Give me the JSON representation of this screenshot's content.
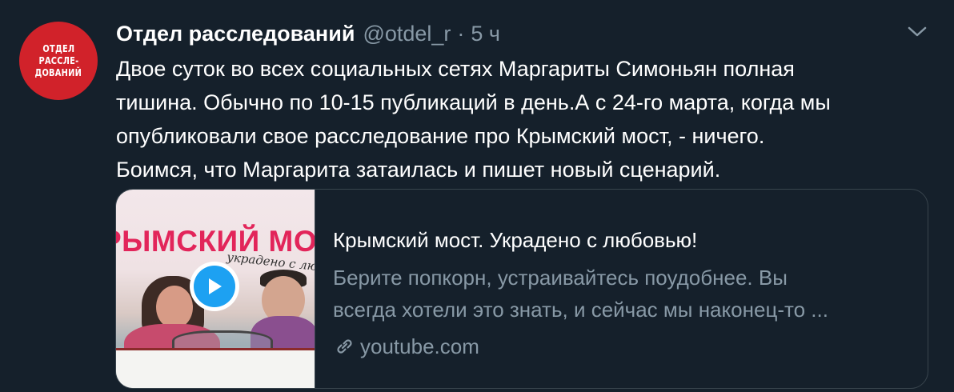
{
  "author": {
    "avatar_lines": [
      "ОТДЕЛ",
      "РАССЛЕ-",
      "ДОВАНИЙ"
    ],
    "name": "Отдел расследований",
    "handle": "@otdel_r",
    "separator": "·",
    "time": "5 ч"
  },
  "tweet": {
    "lines": [
      "Двое суток во всех социальных сетях Маргариты Симоньян полная",
      "тишина. Обычно по 10-15 публикаций в день.А с 24-го марта, когда мы",
      "опубликовали свое расследование про Крымский мост, - ничего.",
      "Боимся, что Маргарита затаилась и пишет новый сценарий."
    ]
  },
  "card": {
    "thumbnail_title": "РЫМСКИЙ МОСТ",
    "thumbnail_subtitle": "украдено с любо",
    "title": "Крымский мост. Украдено с любовью!",
    "description_lines": [
      "Берите попкорн, устраивайтесь поудобнее. Вы",
      "всегда хотели это знать, и сейчас мы наконец-то ..."
    ],
    "domain": "youtube.com",
    "play_icon": "play-icon",
    "link_icon": "link-icon"
  },
  "colors": {
    "background": "#15202b",
    "secondary_text": "#8899a6",
    "border": "#38444d",
    "accent": "#1da1f2",
    "avatar_red": "#d1222a"
  },
  "icons": {
    "caret": "chevron-down-icon"
  }
}
